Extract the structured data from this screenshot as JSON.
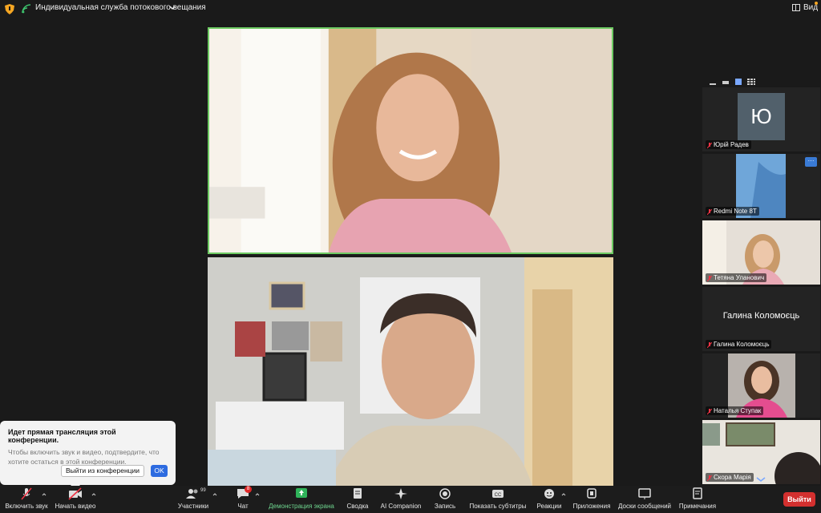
{
  "window": {
    "title": "Индивидуальная служба потокового вещания",
    "view_label": "Вид"
  },
  "colors": {
    "active_speaker_border": "#6ecb63",
    "leave": "#d3302f",
    "accent": "#2d6be0",
    "badge": "#e02828"
  },
  "participants": [
    {
      "name": "Юрій Радев",
      "avatar_letter": "Ю",
      "mic": "muted",
      "video": "off"
    },
    {
      "name": "Redmi Note 8T",
      "mic": "muted",
      "video": "on"
    },
    {
      "name": "Тетяна Уланович",
      "mic": "muted",
      "video": "on"
    },
    {
      "name": "Галина Коломоєць",
      "mic": "muted",
      "video": "off"
    },
    {
      "name": "Наталья Ступак",
      "mic": "muted",
      "video": "on"
    },
    {
      "name": "Скора Марія",
      "mic": "muted",
      "video": "on"
    }
  ],
  "more_button": "···",
  "notice": {
    "title": "Идет прямая трансляция этой конференции.",
    "body": "Чтобы включить звук и видео, подтвердите, что хотите остаться в этой конференции.",
    "leave_label": "Выйти из конференции",
    "ok_label": "OK"
  },
  "toolbar": {
    "mute_label": "Включить звук",
    "video_label": "Начать видео",
    "participants_label": "Участники",
    "participants_count": "99",
    "chat_label": "Чат",
    "chat_badge": "8",
    "share_label": "Демонстрация экрана",
    "summary_label": "Сводка",
    "ai_label": "AI Companion",
    "record_label": "Запись",
    "captions_label": "Показать субтитры",
    "captions_icon_text": "CC",
    "reactions_label": "Реакции",
    "apps_label": "Приложения",
    "whiteboards_label": "Доски сообщений",
    "notes_label": "Примечания",
    "leave_label": "Выйти"
  },
  "icons": {
    "shield": "shield-icon",
    "live": "live-stream-icon",
    "mic": "mic-muted-icon",
    "video": "video-off-icon",
    "participants": "people-icon",
    "chat": "chat-icon",
    "share": "share-screen-icon",
    "summary": "summary-icon",
    "ai": "sparkle-icon",
    "record": "record-icon",
    "captions": "cc-icon",
    "reactions": "smile-icon",
    "apps": "apps-icon",
    "whiteboards": "whiteboard-icon",
    "notes": "notes-icon"
  }
}
